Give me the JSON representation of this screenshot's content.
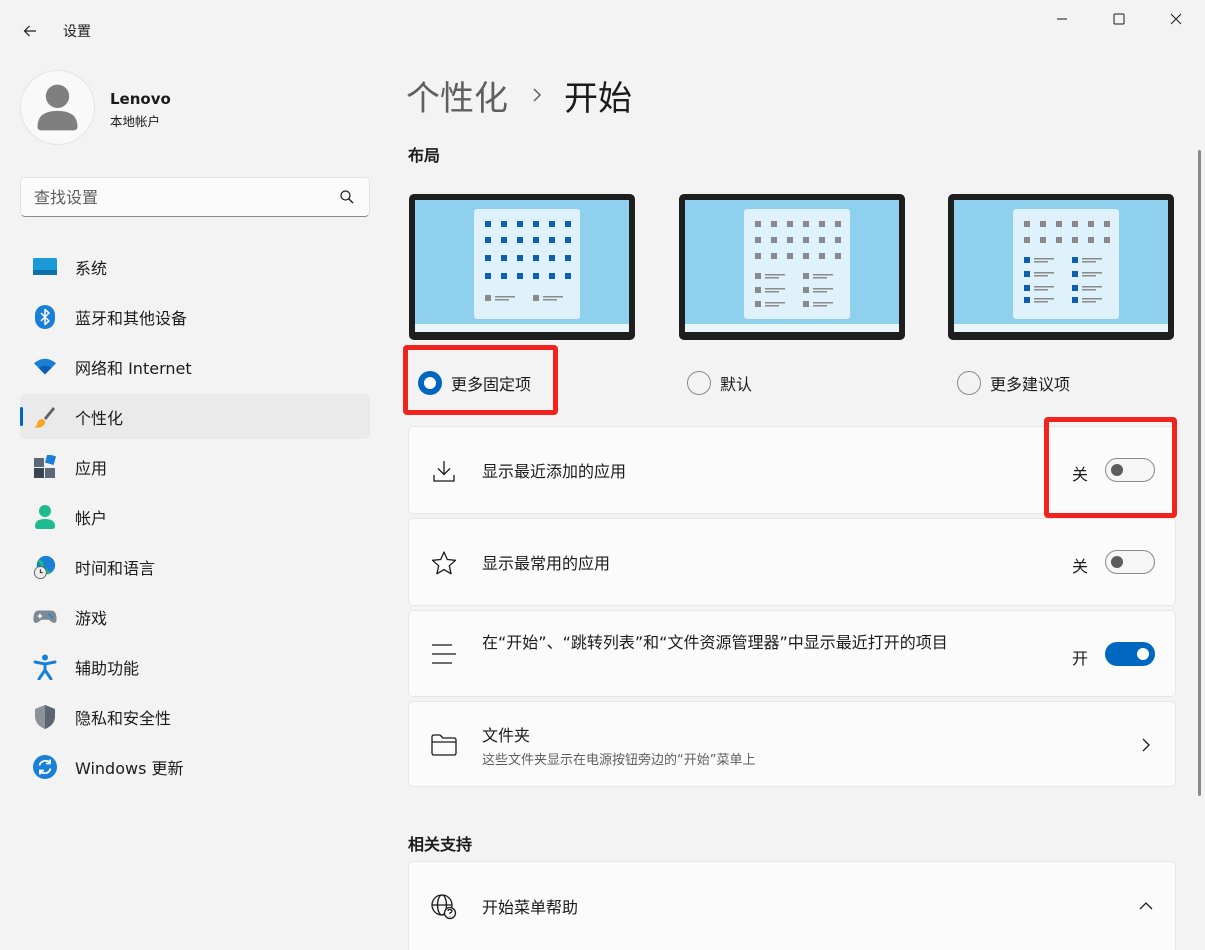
{
  "window": {
    "title": "设置",
    "controls": {
      "minimize": "minimize-icon",
      "maximize": "maximize-icon",
      "close": "close-icon"
    }
  },
  "profile": {
    "name": "Lenovo",
    "account_type": "本地帐户"
  },
  "search": {
    "placeholder": "查找设置"
  },
  "sidebar": {
    "items": [
      {
        "label": "系统",
        "icon": "monitor-icon"
      },
      {
        "label": "蓝牙和其他设备",
        "icon": "bluetooth-icon"
      },
      {
        "label": "网络和 Internet",
        "icon": "wifi-icon"
      },
      {
        "label": "个性化",
        "icon": "brush-icon",
        "active": true
      },
      {
        "label": "应用",
        "icon": "apps-icon"
      },
      {
        "label": "帐户",
        "icon": "person-icon"
      },
      {
        "label": "时间和语言",
        "icon": "globe-clock-icon"
      },
      {
        "label": "游戏",
        "icon": "gamepad-icon"
      },
      {
        "label": "辅助功能",
        "icon": "accessibility-icon"
      },
      {
        "label": "隐私和安全性",
        "icon": "shield-icon"
      },
      {
        "label": "Windows 更新",
        "icon": "update-icon"
      }
    ]
  },
  "breadcrumb": {
    "parent": "个性化",
    "current": "开始"
  },
  "layout_section": {
    "title": "布局",
    "options": [
      {
        "label": "更多固定项",
        "selected": true
      },
      {
        "label": "默认",
        "selected": false
      },
      {
        "label": "更多建议项",
        "selected": false
      }
    ]
  },
  "settings": [
    {
      "title": "显示最近添加的应用",
      "state": "关",
      "on": false,
      "icon": "download-icon"
    },
    {
      "title": "显示最常用的应用",
      "state": "关",
      "on": false,
      "icon": "star-icon"
    },
    {
      "title": "在“开始”、“跳转列表”和“文件资源管理器”中显示最近打开的项目",
      "state": "开",
      "on": true,
      "icon": "list-icon"
    },
    {
      "title": "文件夹",
      "subtitle": "这些文件夹显示在电源按钮旁边的“开始”菜单上",
      "icon": "folder-icon"
    }
  ],
  "related": {
    "title": "相关支持",
    "items": [
      {
        "title": "开始菜单帮助",
        "icon": "globe-icon"
      }
    ]
  },
  "colors": {
    "accent": "#0067c0",
    "highlight": "#f2221e",
    "preview_bg": "#8fd0ef"
  }
}
